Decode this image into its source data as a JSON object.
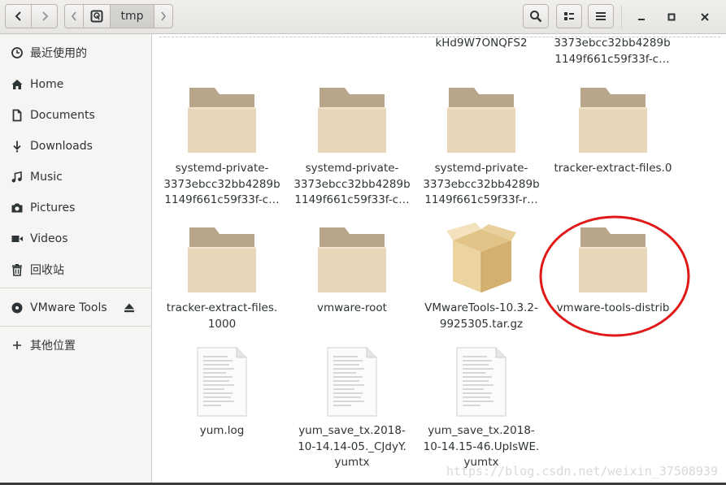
{
  "header": {
    "path_segment": "tmp",
    "icons": {
      "back": "chevron-left-icon",
      "forward": "chevron-right-icon",
      "search": "search-icon",
      "view": "grid-view-icon",
      "menu": "hamburger-menu-icon",
      "minimize": "minimize-icon",
      "maximize": "maximize-icon",
      "close": "close-icon"
    }
  },
  "sidebar": {
    "items": [
      {
        "label": "最近使用的",
        "icon": "clock-icon"
      },
      {
        "label": "Home",
        "icon": "home-icon"
      },
      {
        "label": "Documents",
        "icon": "document-icon"
      },
      {
        "label": "Downloads",
        "icon": "download-icon"
      },
      {
        "label": "Music",
        "icon": "music-icon"
      },
      {
        "label": "Pictures",
        "icon": "camera-icon"
      },
      {
        "label": "Videos",
        "icon": "video-icon"
      },
      {
        "label": "回收站",
        "icon": "trash-icon"
      },
      {
        "label": "VMware Tools",
        "icon": "disc-icon"
      },
      {
        "label": "其他位置",
        "icon": "plus-icon"
      }
    ]
  },
  "files": {
    "partial_top": [
      "kHd9W7ONQFS2",
      "3373ebcc32bb4289b\n1149f661c59f33f-c…"
    ],
    "items": [
      {
        "name": "systemd-private-\n3373ebcc32bb4289b\n1149f661c59f33f-c…",
        "type": "folder"
      },
      {
        "name": "systemd-private-\n3373ebcc32bb4289b\n1149f661c59f33f-c…",
        "type": "folder"
      },
      {
        "name": "systemd-private-\n3373ebcc32bb4289b\n1149f661c59f33f-r…",
        "type": "folder"
      },
      {
        "name": "tracker-extract-files.0",
        "type": "folder"
      },
      {
        "name": "tracker-extract-files.\n1000",
        "type": "folder"
      },
      {
        "name": "vmware-root",
        "type": "folder"
      },
      {
        "name": "VMwareTools-10.3.2-\n9925305.tar.gz",
        "type": "archive"
      },
      {
        "name": "vmware-tools-distrib",
        "type": "folder"
      },
      {
        "name": "yum.log",
        "type": "text"
      },
      {
        "name": "yum_save_tx.2018-\n10-14.14-05._CJdyY.\nyumtx",
        "type": "text"
      },
      {
        "name": "yum_save_tx.2018-\n10-14.15-46.UpIsWE.\nyumtx",
        "type": "text"
      }
    ]
  },
  "watermark": "https://blog.csdn.net/weixin_37508939",
  "colors": {
    "folder_body": "#e8d6b8",
    "folder_tab": "#b8a68a",
    "annotation_circle": "#e01818"
  }
}
